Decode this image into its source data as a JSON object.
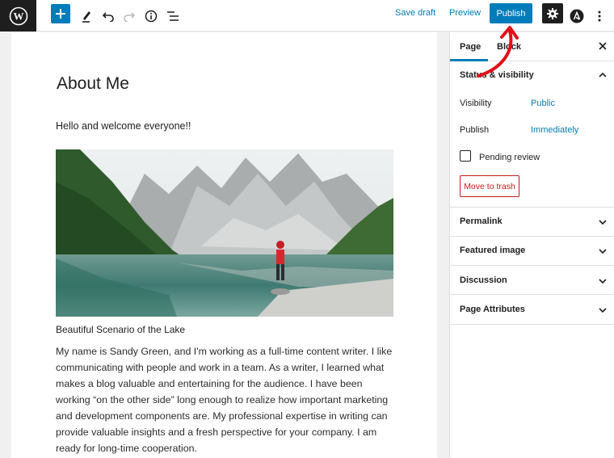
{
  "toolbar": {
    "save_draft": "Save draft",
    "preview": "Preview",
    "publish": "Publish"
  },
  "post": {
    "title": "About Me",
    "intro": "Hello and welcome everyone!!",
    "image_caption": "Beautiful Scenario of the Lake",
    "body": "My name is Sandy Green, and I'm working as a full-time content writer. I like communicating with people and work in a team. As a writer, I learned what makes a blog valuable and entertaining for the audience.  I have been working “on the other side” long enough to realize how important marketing and development components are. My professional expertise in writing can provide valuable insights and a fresh perspective for your company. I am ready for long-time cooperation."
  },
  "sidebar": {
    "tabs": [
      "Page",
      "Block"
    ],
    "status_panel": {
      "title": "Status & visibility",
      "visibility_label": "Visibility",
      "visibility_value": "Public",
      "publish_label": "Publish",
      "publish_value": "Immediately",
      "pending_review": "Pending review",
      "move_to_trash": "Move to trash"
    },
    "panels": [
      "Permalink",
      "Featured image",
      "Discussion",
      "Page Attributes"
    ]
  },
  "colors": {
    "accent": "#007cba",
    "danger": "#cc1818",
    "annotation_arrow": "#e0101a"
  },
  "icons": [
    "wordpress-logo-icon",
    "plus-icon",
    "pencil-icon",
    "undo-icon",
    "redo-icon",
    "info-icon",
    "list-view-icon",
    "gear-icon",
    "astra-icon",
    "more-vertical-icon",
    "close-icon",
    "chevron-up-icon",
    "chevron-down-icon"
  ]
}
